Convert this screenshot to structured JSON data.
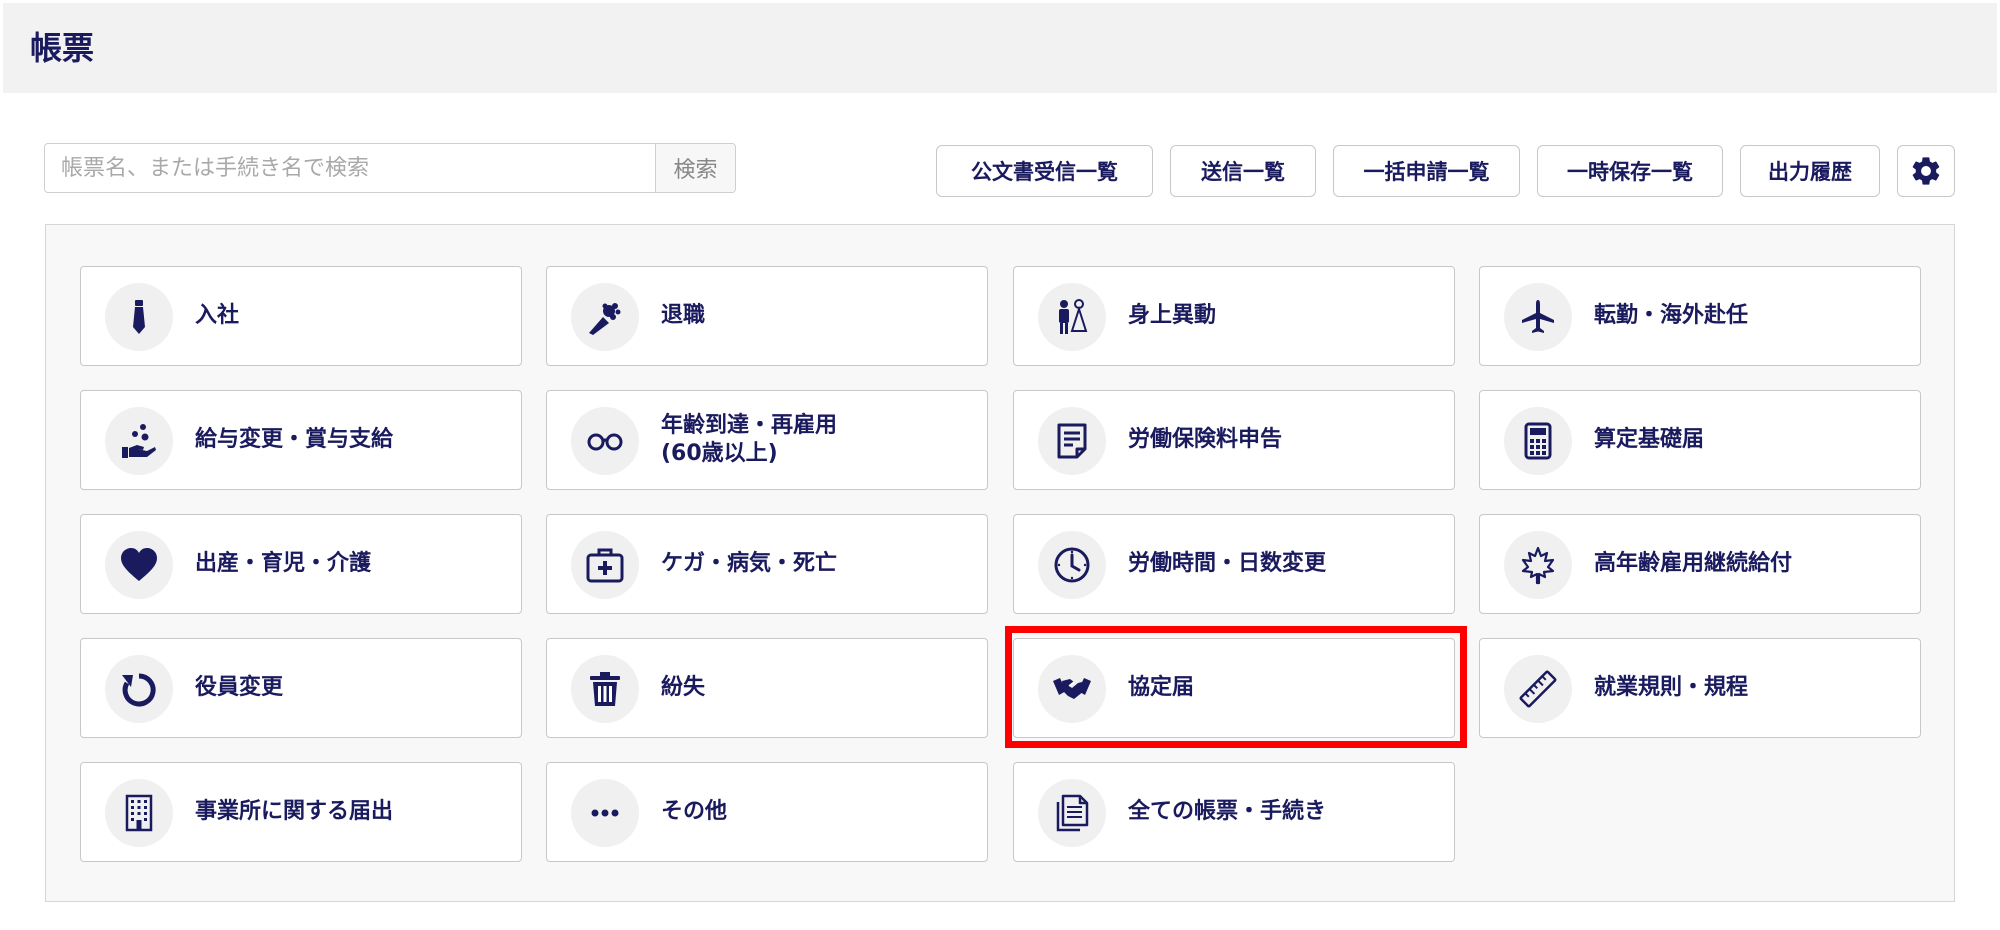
{
  "header": {
    "title": "帳票"
  },
  "search": {
    "placeholder": "帳票名、または手続き名で検索",
    "button_label": "検索"
  },
  "toolbar": {
    "received_docs": "公文書受信一覧",
    "sent_list": "送信一覧",
    "bulk_list": "一括申請一覧",
    "temp_saved": "一時保存一覧",
    "output_history": "出力履歴",
    "settings_icon": "gear-icon"
  },
  "tiles": [
    {
      "label": "入社",
      "icon": "necktie-icon"
    },
    {
      "label": "退職",
      "icon": "bouquet-icon"
    },
    {
      "label": "身上異動",
      "icon": "wedding-couple-icon"
    },
    {
      "label": "転勤・海外赴任",
      "icon": "airplane-icon"
    },
    {
      "label": "給与変更・賞与支給",
      "icon": "hand-coins-icon"
    },
    {
      "label": "年齢到達・再雇用",
      "label2": "(60歳以上)",
      "icon": "glasses-icon"
    },
    {
      "label": "労働保険料申告",
      "icon": "document-icon"
    },
    {
      "label": "算定基礎届",
      "icon": "calculator-icon"
    },
    {
      "label": "出産・育児・介護",
      "icon": "heart-icon"
    },
    {
      "label": "ケガ・病気・死亡",
      "icon": "first-aid-kit-icon"
    },
    {
      "label": "労働時間・日数変更",
      "icon": "clock-icon"
    },
    {
      "label": "高年齢雇用継続給付",
      "icon": "maple-leaf-icon"
    },
    {
      "label": "役員変更",
      "icon": "refresh-icon"
    },
    {
      "label": "紛失",
      "icon": "trash-icon"
    },
    {
      "label": "協定届",
      "icon": "handshake-icon"
    },
    {
      "label": "就業規則・規程",
      "icon": "ruler-icon"
    },
    {
      "label": "事業所に関する届出",
      "icon": "building-icon"
    },
    {
      "label": "その他",
      "icon": "more-dots-icon"
    },
    {
      "label": "全ての帳票・手続き",
      "icon": "documents-stack-icon"
    }
  ],
  "colors": {
    "accent": "#1a1a5e",
    "highlight": "#ff0000",
    "header_bg": "#f2f2f2"
  }
}
